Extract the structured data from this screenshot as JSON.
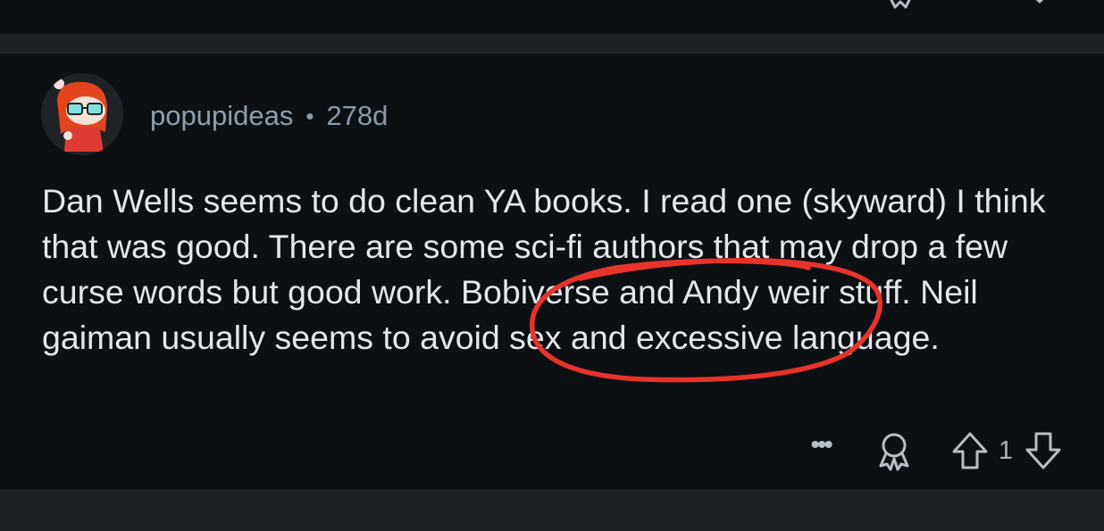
{
  "comment": {
    "username": "popupideas",
    "separator": "•",
    "age": "278d",
    "text": "Dan Wells seems to do clean YA books. I read one (skyward) I think that was good. There are some sci-fi authors that may drop a few curse words but good work. Bobiverse and Andy weir stuff. Neil gaiman usually seems to avoid sex and excessive language.",
    "more_label": "•••",
    "vote_count": "1"
  },
  "annotation": {
    "type": "red-hand-drawn-circle",
    "color": "#e8332a"
  },
  "colors": {
    "background": "#0d1013",
    "separator": "#1d2024",
    "body_text": "#e4e7ea",
    "meta_text": "#8a9aa8",
    "icon": "#b7bec5"
  },
  "icons": {
    "avatar": "snoo-avatar-glasses",
    "award": "award-icon",
    "upvote": "upvote-arrow-icon",
    "downvote": "downvote-arrow-icon"
  }
}
